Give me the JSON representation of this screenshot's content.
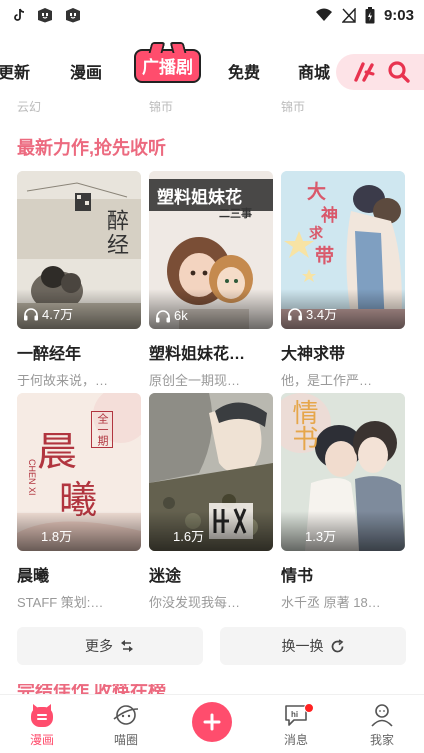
{
  "status_bar": {
    "time": "9:03",
    "left_icons": [
      "tiktok-icon",
      "package-icon",
      "package-icon"
    ],
    "right_icons": [
      "wifi-icon",
      "no-signal-icon",
      "battery-charging-icon"
    ]
  },
  "top_nav": {
    "tabs": [
      {
        "label": "更新"
      },
      {
        "label": "漫画"
      },
      {
        "label": "广播剧",
        "active": true
      },
      {
        "label": "免费"
      },
      {
        "label": "商城"
      }
    ],
    "tools": [
      "brush-icon",
      "search-icon"
    ]
  },
  "previous_row_remnants": [
    "云幻",
    "锦帀",
    "锦帀"
  ],
  "section": {
    "title": "最新力作,抢先收听",
    "items": [
      {
        "title": "一醉经年",
        "subtitle": "于何故来说，…",
        "plays": "4.7万",
        "cover_color": "#e8e4dc"
      },
      {
        "title": "塑料姐妹花…",
        "subtitle": "原创全一期现…",
        "plays": "6k",
        "cover_color": "#efe9e4"
      },
      {
        "title": "大神求带",
        "subtitle": "他，是工作严…",
        "plays": "3.4万",
        "cover_color": "#cfe7f0"
      },
      {
        "title": "晨曦",
        "subtitle": "STAFF 策划:…",
        "plays": "1.8万",
        "cover_color": "#f6ebe4"
      },
      {
        "title": "迷途",
        "subtitle": "你没发现我每…",
        "plays": "1.6万",
        "cover_color": "#b9b8b0"
      },
      {
        "title": "情书",
        "subtitle": "水千丞 原著 18…",
        "plays": "1.3万",
        "cover_color": "#dde4dc"
      }
    ],
    "cover_texts": {
      "c1": "醉经",
      "c2": "塑料姐妹花",
      "c2b": "二三事",
      "c3a": "大",
      "c3b": "神",
      "c3c": "求",
      "c3d": "带",
      "c4a": "全一期",
      "c4b": "晨",
      "c4c": "曦",
      "c4d": "CHEN XI",
      "c6": "情书"
    }
  },
  "actions": {
    "more_label": "更多",
    "refresh_label": "换一换"
  },
  "next_section_title": "完结佳作 收筷在榜",
  "bottom_nav": {
    "items": [
      {
        "label": "漫画",
        "active": true
      },
      {
        "label": "喵圈"
      },
      {
        "label": ""
      },
      {
        "label": "消息",
        "badge": true
      },
      {
        "label": "我家"
      }
    ]
  },
  "colors": {
    "accent": "#ff4d6d",
    "section_title": "#ec6a7f"
  }
}
